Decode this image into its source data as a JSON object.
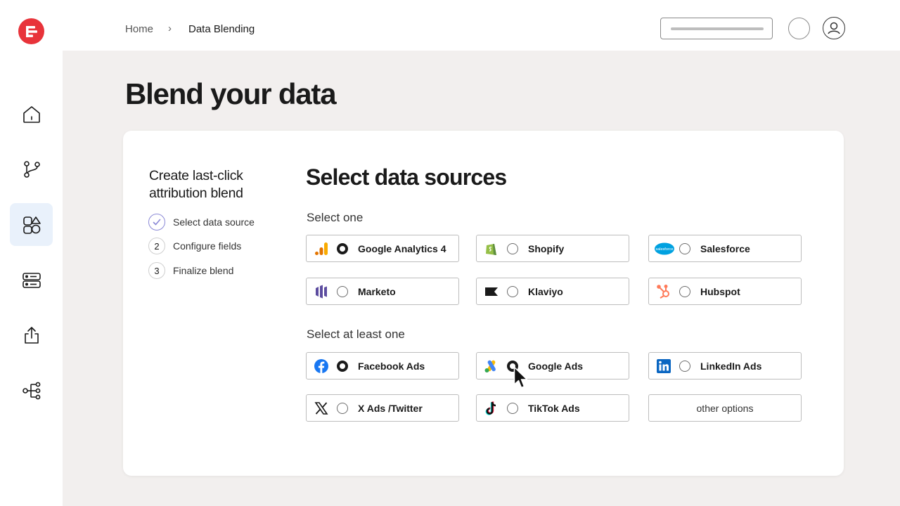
{
  "breadcrumb": {
    "home": "Home",
    "separator": "›",
    "current": "Data Blending"
  },
  "header": {
    "search_icon": "search-placeholder-bar",
    "circle_button_icon": "circle-icon",
    "avatar_icon": "user-icon"
  },
  "sidebar": {
    "logo_icon": "brand-logo-icon",
    "items": [
      {
        "icon": "home-icon"
      },
      {
        "icon": "branch-icon"
      },
      {
        "icon": "shapes-icon",
        "active": true
      },
      {
        "icon": "server-icon"
      },
      {
        "icon": "upload-icon"
      },
      {
        "icon": "flow-icon"
      }
    ]
  },
  "page": {
    "title": "Blend your data"
  },
  "steps": {
    "title": "Create last-click attribution blend",
    "items": [
      {
        "marker": "✓",
        "label": "Select data source",
        "status": "done"
      },
      {
        "marker": "2",
        "label": "Configure fields",
        "status": "pending"
      },
      {
        "marker": "3",
        "label": "Finalize blend",
        "status": "pending"
      }
    ]
  },
  "sources": {
    "title": "Select data sources",
    "group1": {
      "label": "Select one",
      "options": [
        {
          "label": "Google Analytics 4",
          "icon": "google-analytics-icon",
          "selected": true
        },
        {
          "label": "Shopify",
          "icon": "shopify-icon",
          "selected": false
        },
        {
          "label": "Salesforce",
          "icon": "salesforce-icon",
          "selected": false
        },
        {
          "label": "Marketo",
          "icon": "marketo-icon",
          "selected": false
        },
        {
          "label": "Klaviyo",
          "icon": "klaviyo-icon",
          "selected": false
        },
        {
          "label": "Hubspot",
          "icon": "hubspot-icon",
          "selected": false
        }
      ]
    },
    "group2": {
      "label": "Select at least one",
      "options": [
        {
          "label": "Facebook Ads",
          "icon": "facebook-icon",
          "selected": true
        },
        {
          "label": "Google Ads",
          "icon": "google-ads-icon",
          "selected": true
        },
        {
          "label": "LinkedIn Ads",
          "icon": "linkedin-icon",
          "selected": false
        },
        {
          "label": "X Ads /Twitter",
          "icon": "x-icon",
          "selected": false
        },
        {
          "label": "TikTok Ads",
          "icon": "tiktok-icon",
          "selected": false
        },
        {
          "label": "other options",
          "icon": "",
          "selected": false
        }
      ]
    }
  },
  "colors": {
    "brand": "#e8333a",
    "background": "#f2efee",
    "active_nav": "#e9f1fb",
    "step_done": "#8a88d6"
  }
}
